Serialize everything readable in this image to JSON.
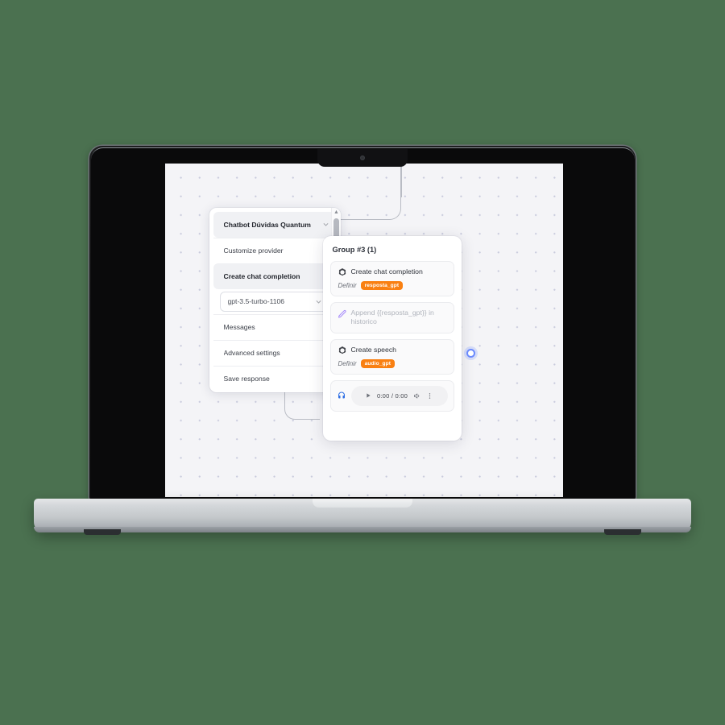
{
  "background_color": "#4b7150",
  "device": {
    "name": "laptop-mockup",
    "type": "MacBook Pro",
    "body_color": "#c4c8cb",
    "bezel_color": "#0a0a0b"
  },
  "canvas": {
    "name": "flow-canvas",
    "background_color": "#f4f4f7",
    "dot_color": "#c9cbdd"
  },
  "panel": {
    "rows": [
      {
        "label": "Chatbot Dúvidas Quantum",
        "state": "active",
        "style": "highlight"
      },
      {
        "label": "Customize provider",
        "state": "normal",
        "style": "plain"
      },
      {
        "label": "Create chat completion",
        "state": "active",
        "style": "highlight"
      },
      {
        "label": "gpt-3.5-turbo-1106",
        "state": "normal",
        "style": "boxed"
      },
      {
        "label": "Messages",
        "state": "normal",
        "style": "plain"
      },
      {
        "label": "Advanced settings",
        "state": "normal",
        "style": "plain"
      },
      {
        "label": "Save response",
        "state": "normal",
        "style": "plain"
      }
    ],
    "scrollbar": {
      "up_arrow": "▲",
      "down_arrow": "▼"
    }
  },
  "group_card": {
    "title": "Group #3 (1)",
    "blocks": [
      {
        "icon": "openai-icon",
        "title": "Create chat completion",
        "sub_label": "Definir",
        "badge": "resposta_gpt",
        "dimmed": false
      },
      {
        "icon": "pencil-icon",
        "title": "Append {{resposta_gpt}} in historico",
        "sub_label": "",
        "badge": "",
        "dimmed": true
      },
      {
        "icon": "openai-icon",
        "title": "Create speech",
        "sub_label": "Definir",
        "badge": "audio_gpt",
        "dimmed": false
      }
    ],
    "audio": {
      "icon": "headphones-icon",
      "play_icon": "play-icon",
      "time": "0:00  / 0:00",
      "volume_icon": "volume-icon",
      "menu_icon": "more-vertical-icon"
    },
    "badge_color": "#f98012",
    "port_label": "output-port"
  }
}
